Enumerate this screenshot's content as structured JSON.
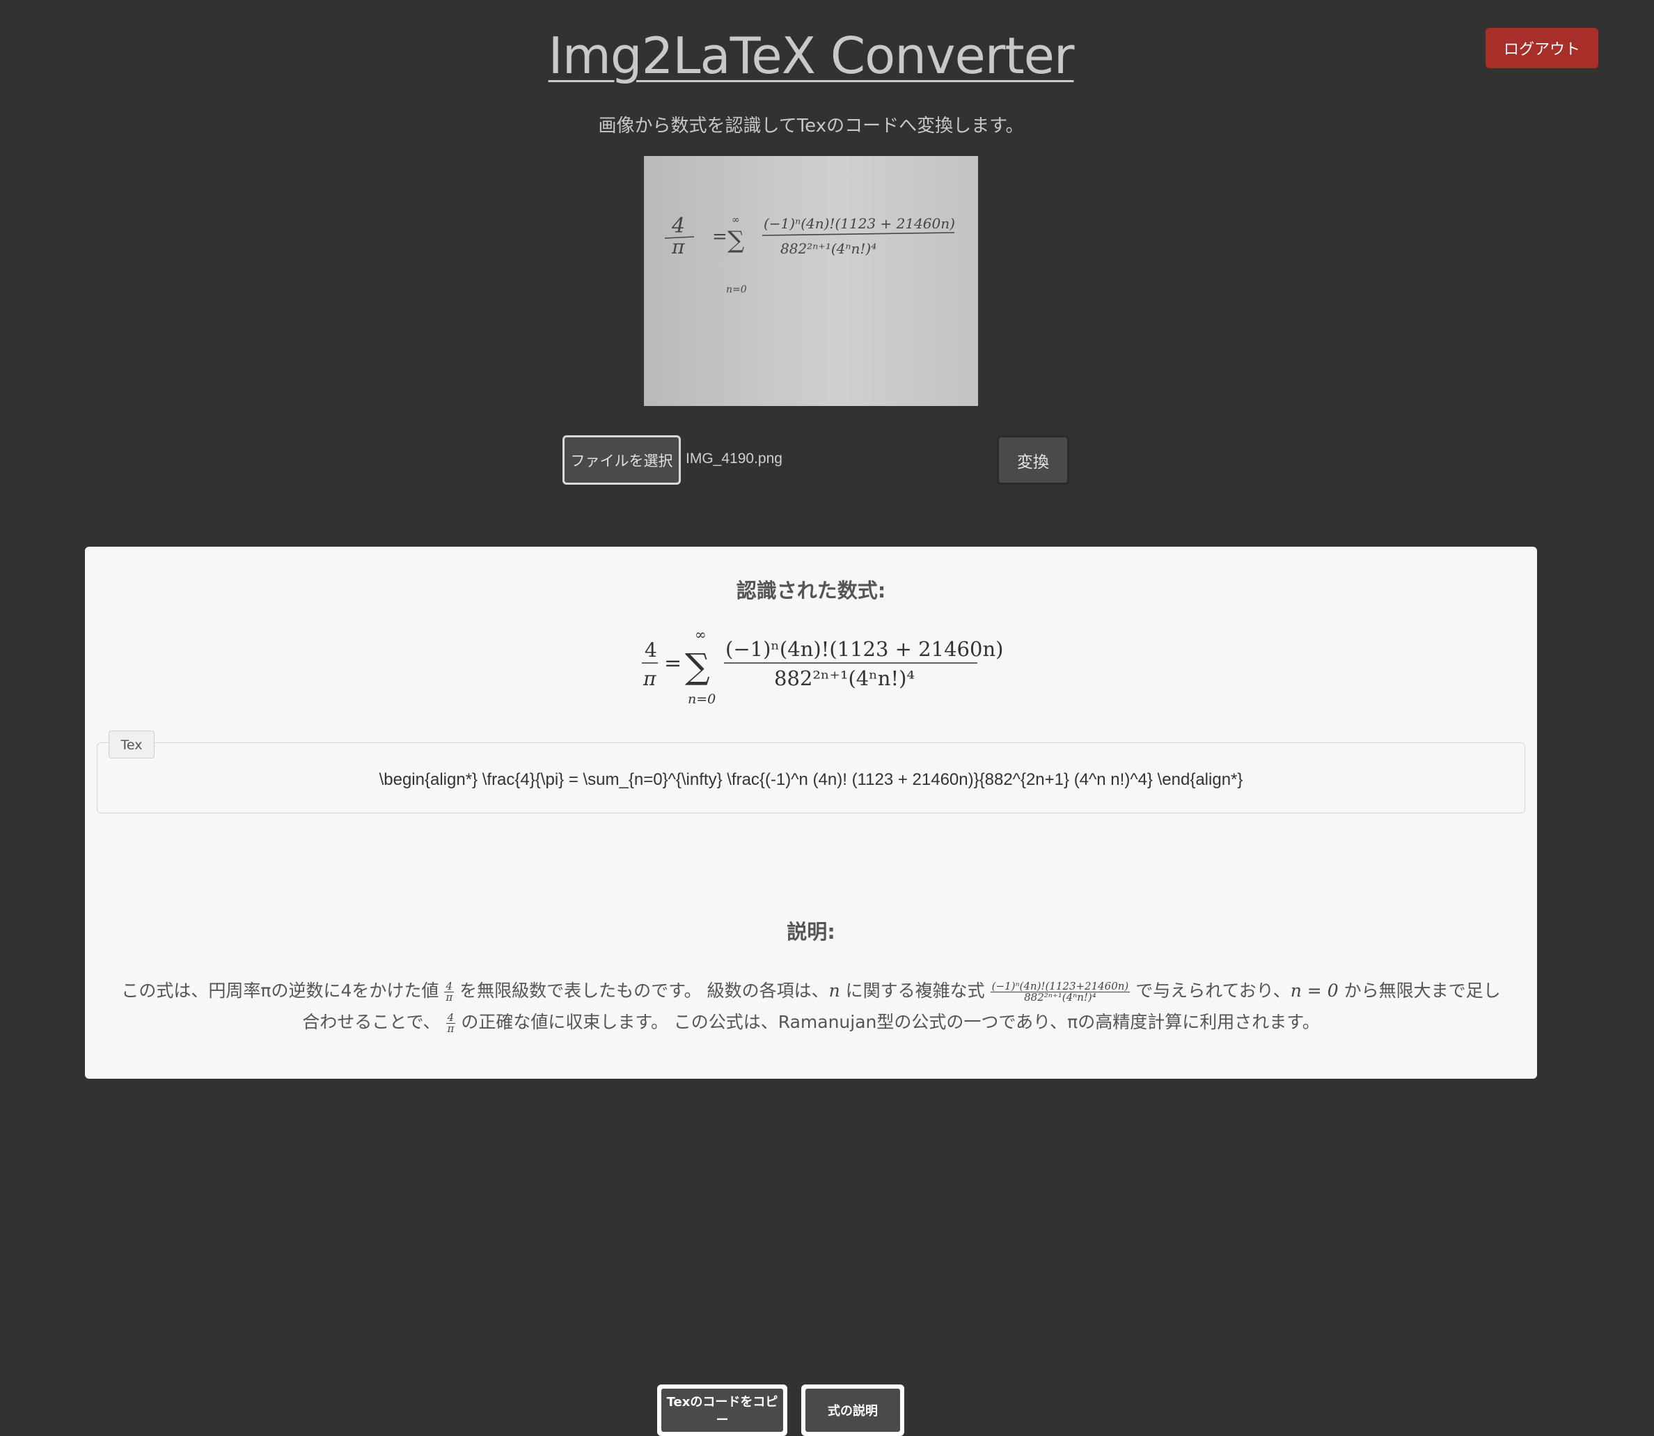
{
  "header": {
    "title": "Img2LaTeX Converter",
    "subtitle": "画像から数式を認識してTexのコードへ変換します。",
    "logout_label": "ログアウト"
  },
  "upload": {
    "file_button_label": "ファイルを選択",
    "file_name": "IMG_4190.png",
    "convert_label": "変換"
  },
  "result": {
    "heading": "認識された数式:",
    "tex_tab_label": "Tex",
    "tex_code": "\\begin{align*} \\frac{4}{\\pi} = \\sum_{n=0}^{\\infty} \\frac{(-1)^n (4n)! (1123 + 21460n)}{882^{2n+1} (4^n n!)^4} \\end{align*}",
    "copy_button_label": "Texのコードをコピー",
    "explain_button_label": "式の説明",
    "explanation_heading": "説明:",
    "explanation": {
      "p1": "この式は、円周率πの逆数に4をかけた値",
      "p2": "を無限級数で表したものです。 級数の各項は、",
      "p3": "に関する複雑な式",
      "p4": "で与えられており、",
      "p5": "から無限大まで足し合わせることで、",
      "p6": "の正確な値に収束します。 この公式は、Ramanujan型の公式の一つであり、πの高精度計算に利用されます。"
    }
  },
  "formula": {
    "lhs_num": "4",
    "lhs_den": "π",
    "equals": "=",
    "sum_sign": "∑",
    "sum_upper": "∞",
    "sum_lower": "n=0",
    "rhs_num": "(−1)ⁿ(4n)!(1123 + 21460n)",
    "rhs_den": "882²ⁿ⁺¹(4ⁿn!)⁴",
    "var_n": "n",
    "cond": "n = 0",
    "small_num": "(−1)ⁿ(4n)!(1123+21460n)",
    "small_den": "882²ⁿ⁺¹(4ⁿn!)⁴"
  },
  "colors": {
    "background": "#323232",
    "panel": "#f7f7f7",
    "logout": "#a82e2a",
    "button": "#4a4a4a"
  }
}
